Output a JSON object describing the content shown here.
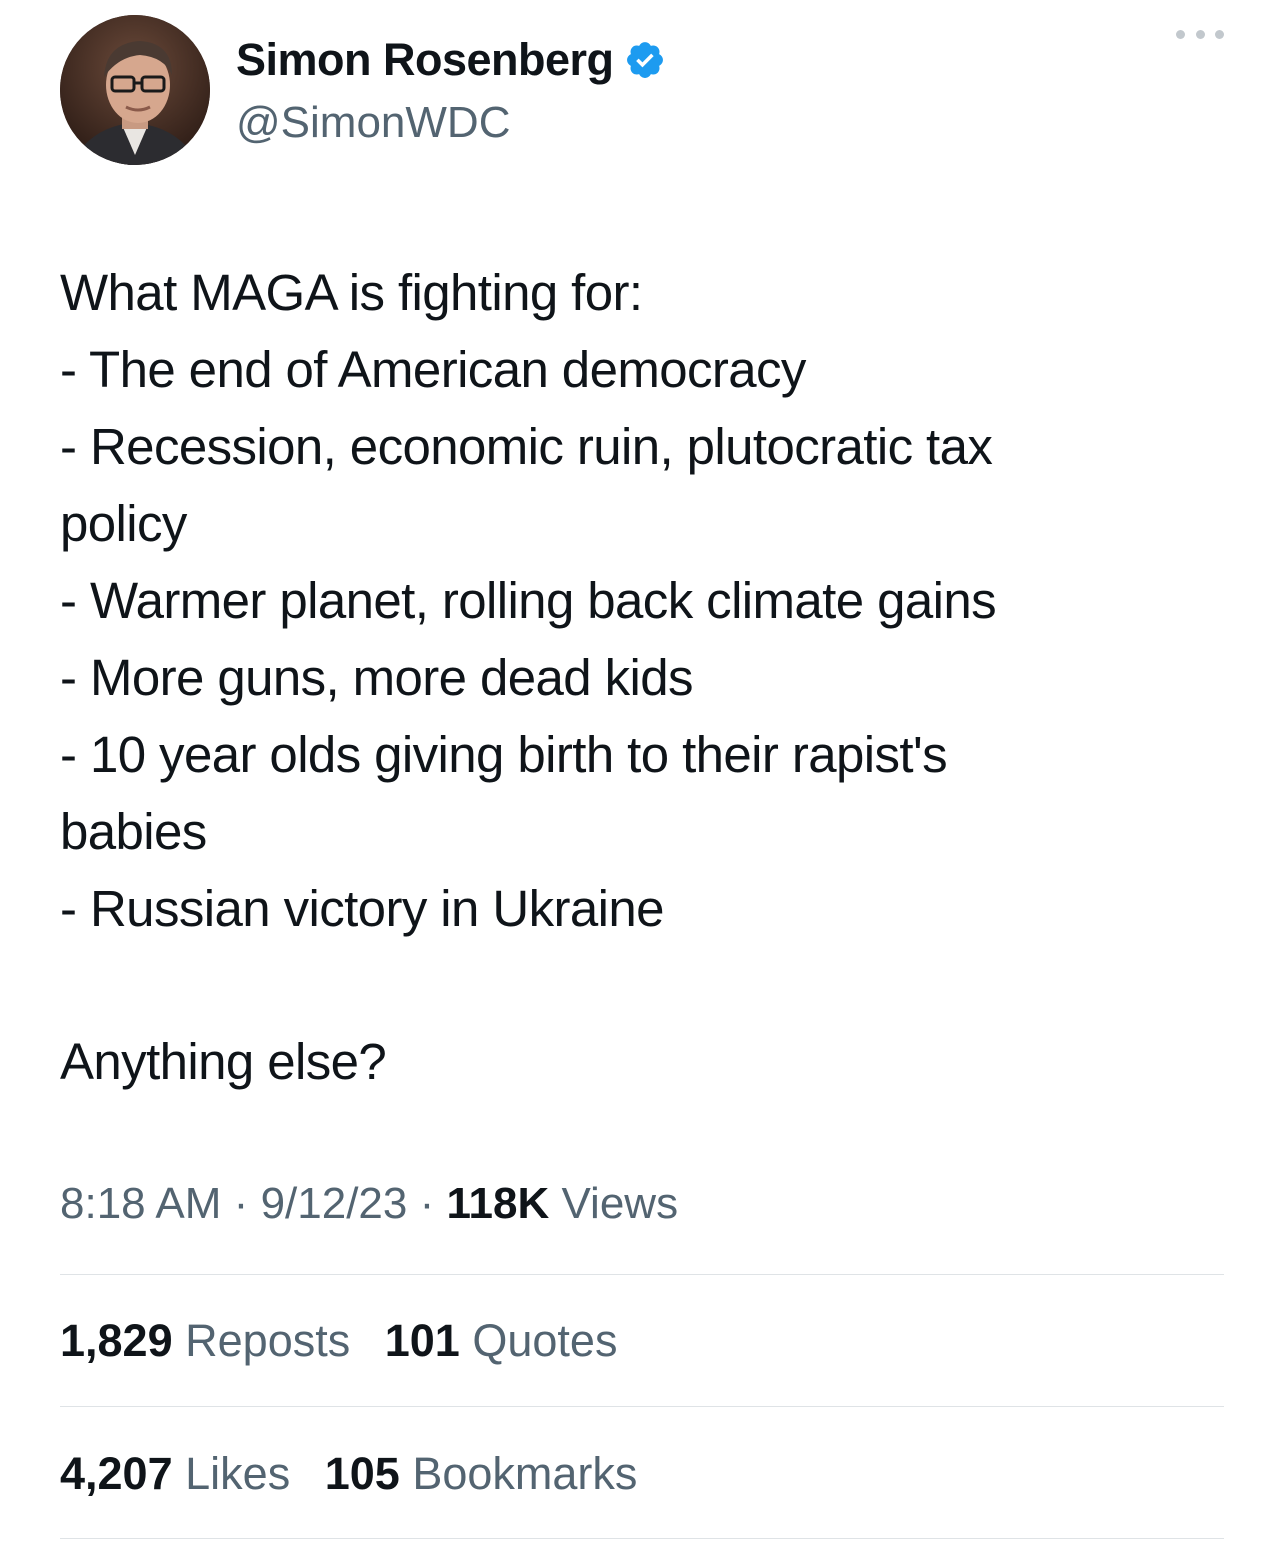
{
  "author": {
    "display_name": "Simon Rosenberg",
    "handle": "@SimonWDC",
    "verified_icon": "verified-badge-icon",
    "avatar_icon": "avatar"
  },
  "tweet": {
    "lines": [
      "What MAGA is fighting for:",
      "- The end of American democracy",
      "- Recession, economic ruin, plutocratic tax",
      "policy",
      "- Warmer planet, rolling back climate gains",
      "- More guns, more dead kids",
      "- 10 year olds giving birth to their rapist's",
      "babies",
      "- Russian victory in Ukraine"
    ],
    "closing": "Anything else?"
  },
  "meta": {
    "time": "8:18 AM",
    "separator": "·",
    "date": "9/12/23",
    "views_count": "118K",
    "views_label": "Views"
  },
  "stats": {
    "reposts_count": "1,829",
    "reposts_label": "Reposts",
    "quotes_count": "101",
    "quotes_label": "Quotes",
    "likes_count": "4,207",
    "likes_label": "Likes",
    "bookmarks_count": "105",
    "bookmarks_label": "Bookmarks"
  },
  "colors": {
    "primary_text": "#0f1419",
    "secondary_text": "#536471",
    "verified_blue": "#1d9bf0",
    "divider": "#dfe3e6"
  },
  "more_icon": "more-options-icon"
}
